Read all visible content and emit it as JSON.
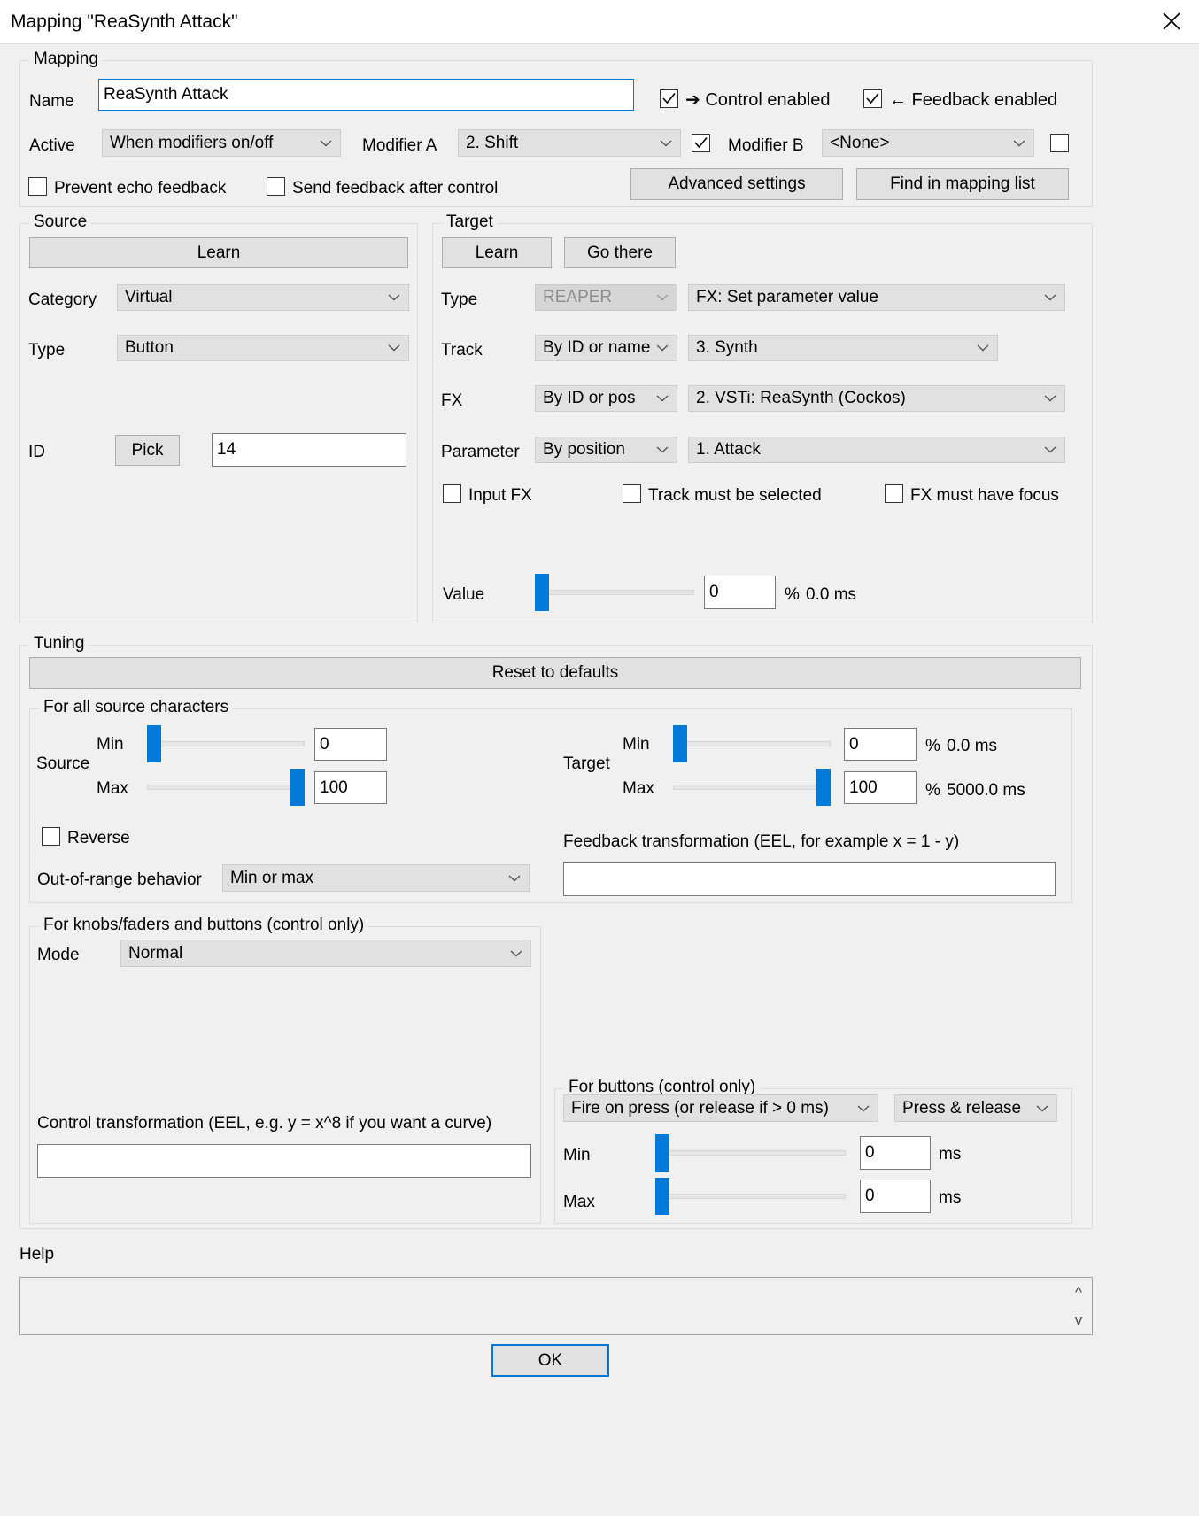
{
  "window": {
    "title": "Mapping \"ReaSynth Attack\"",
    "close_icon": "close-icon"
  },
  "mapping": {
    "legend": "Mapping",
    "name_label": "Name",
    "name_value": "ReaSynth Attack",
    "control_enabled_label": "➔ Control enabled",
    "control_enabled_checked": true,
    "feedback_enabled_label": "← Feedback enabled",
    "feedback_enabled_checked": true,
    "active_label": "Active",
    "active_value": "When modifiers on/off",
    "modifier_a_label": "Modifier A",
    "modifier_a_value": "2. Shift",
    "modifier_a_checked": true,
    "modifier_b_label": "Modifier B",
    "modifier_b_value": "<None>",
    "modifier_b_checked": false,
    "prevent_echo_label": "Prevent echo feedback",
    "prevent_echo_checked": false,
    "send_feedback_label": "Send feedback after control",
    "send_feedback_checked": false,
    "advanced_settings_label": "Advanced settings",
    "find_in_mapping_list_label": "Find in mapping list"
  },
  "source": {
    "legend": "Source",
    "learn_label": "Learn",
    "category_label": "Category",
    "category_value": "Virtual",
    "type_label": "Type",
    "type_value": "Button",
    "id_label": "ID",
    "pick_label": "Pick",
    "id_value": "14"
  },
  "target": {
    "legend": "Target",
    "learn_label": "Learn",
    "go_there_label": "Go there",
    "type_label": "Type",
    "type_category_value": "REAPER",
    "type_value": "FX: Set parameter value",
    "track_label": "Track",
    "track_mode_value": "By ID or name",
    "track_value": "3. Synth",
    "fx_label": "FX",
    "fx_mode_value": "By ID or pos",
    "fx_value": "2. VSTi: ReaSynth (Cockos)",
    "parameter_label": "Parameter",
    "parameter_mode_value": "By position",
    "parameter_value": "1. Attack",
    "input_fx_label": "Input FX",
    "input_fx_checked": false,
    "track_must_be_selected_label": "Track must be selected",
    "track_must_be_selected_checked": false,
    "fx_must_have_focus_label": "FX must have focus",
    "fx_must_have_focus_checked": false,
    "value_label": "Value",
    "value_number": "0",
    "value_percent_unit": "%",
    "value_ms": "0.0 ms",
    "value_slider_pct": 0
  },
  "tuning": {
    "legend": "Tuning",
    "reset_label": "Reset to defaults",
    "all_source_characters": {
      "legend": "For all source characters",
      "source_label": "Source",
      "source_min_label": "Min",
      "source_min_value": "0",
      "source_min_slider_pct": 0,
      "source_max_label": "Max",
      "source_max_value": "100",
      "source_max_slider_pct": 100,
      "target_label": "Target",
      "target_min_label": "Min",
      "target_min_value": "0",
      "target_min_unit": "%",
      "target_min_ms": "0.0 ms",
      "target_min_slider_pct": 0,
      "target_max_label": "Max",
      "target_max_value": "100",
      "target_max_unit": "%",
      "target_max_ms": "5000.0 ms",
      "target_max_slider_pct": 100,
      "reverse_label": "Reverse",
      "reverse_checked": false,
      "out_of_range_label": "Out-of-range behavior",
      "out_of_range_value": "Min or max",
      "feedback_transformation_label": "Feedback transformation (EEL, for example x = 1 - y)",
      "feedback_transformation_value": ""
    },
    "knobs_faders": {
      "legend": "For knobs/faders and buttons (control only)",
      "mode_label": "Mode",
      "mode_value": "Normal",
      "control_transformation_label": "Control transformation (EEL, e.g. y = x^8 if you want a curve)",
      "control_transformation_value": ""
    },
    "buttons": {
      "legend": "For buttons (control only)",
      "fire_mode_value": "Fire on press (or release if > 0 ms)",
      "press_mode_value": "Press & release",
      "min_label": "Min",
      "min_value": "0",
      "min_unit": "ms",
      "min_slider_pct": 0,
      "max_label": "Max",
      "max_value": "0",
      "max_unit": "ms",
      "max_slider_pct": 0
    }
  },
  "help": {
    "legend": "Help",
    "content": "",
    "scroll_up_icon": "chevron-up-icon",
    "scroll_down_icon": "chevron-down-icon"
  },
  "footer": {
    "ok_label": "OK"
  }
}
